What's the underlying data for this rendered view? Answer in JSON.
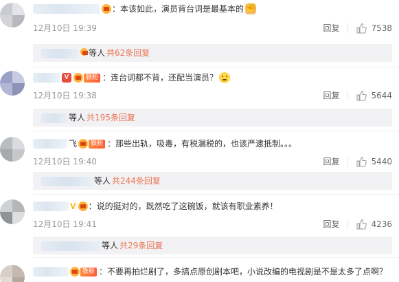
{
  "comments": [
    {
      "text": "：本该如此，演员背台词是最基本的",
      "emoji": "fist-emoji",
      "date": "12月10日 19:39",
      "reply_label": "回复",
      "likes": "7538",
      "replies": {
        "etc": "等人",
        "more": "共62条回复"
      }
    },
    {
      "text": "：连台词都不背，还配当演员？",
      "emoji": "thinking-emoji",
      "fan_tag": "铁粉",
      "date": "12月10日 19:38",
      "reply_label": "回复",
      "likes": "5644",
      "replies": {
        "etc": "等人",
        "more": "共195条回复"
      }
    },
    {
      "name_fragment": "飞",
      "fan_tag": "铁粉",
      "text": "：那些出轨，吸毒，有税漏税的，也该严逮抵制。。。",
      "date": "12月10日 19:40",
      "reply_label": "回复",
      "likes": "5440",
      "replies": {
        "etc": "等人",
        "more": "共244条回复"
      }
    },
    {
      "text": "：说的挺对的，既然吃了这碗饭，就该有职业素养！",
      "date": "12月10日 19:41",
      "reply_label": "回复",
      "likes": "4236",
      "replies": {
        "etc": "等人",
        "more": "共29条回复"
      }
    },
    {
      "fan_tag": "铁粉",
      "text": "：不要再拍烂剧了，多搞点原创剧本吧，小说改编的电视剧是不是太多了点啊？"
    }
  ],
  "colors": {
    "link": "#eb7350",
    "reply_bg": "#f2f2f5",
    "meta": "#999999"
  }
}
